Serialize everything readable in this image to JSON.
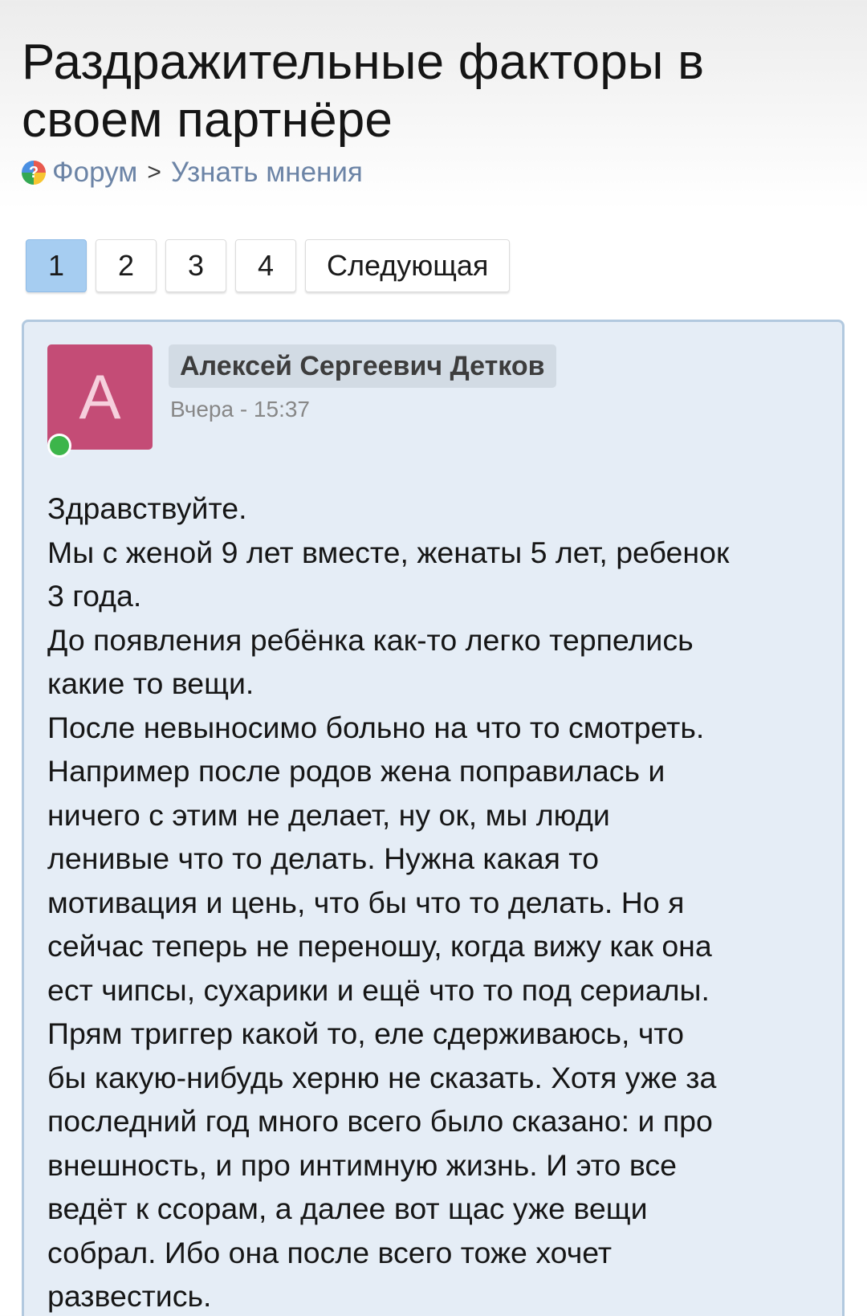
{
  "page": {
    "title_line1": "Раздражительные факторы в",
    "title_line2": "своем партнёре"
  },
  "breadcrumb": {
    "icon": "question-icon",
    "forum": "Форум",
    "separator": ">",
    "section": "Узнать мнения"
  },
  "pagination": {
    "pages": [
      "1",
      "2",
      "3",
      "4"
    ],
    "current": "1",
    "next_label": "Следующая"
  },
  "post": {
    "avatar_letter": "А",
    "avatar_color": "#c44c76",
    "online_color": "#3cb54a",
    "author": "Алексей Сергеевич Детков",
    "time": "Вчера - 15:37",
    "lines": [
      "Здравствуйте.",
      "Мы с женой 9 лет вместе, женаты 5 лет, ребенок",
      "3 года.",
      "До появления ребёнка как-то легко терпелись",
      "какие то вещи.",
      "После невыносимо больно на что то смотреть.",
      "Например после родов жена поправилась и",
      "ничего с этим не делает, ну ок, мы люди",
      "ленивые что то делать. Нужна какая то",
      "мотивация и цень, что бы что то делать. Но я",
      "сейчас теперь не переношу, когда вижу как она",
      "ест чипсы, сухарики и ещё что то под сериалы.",
      "Прям триггер какой то, еле сдерживаюсь, что",
      "бы какую-нибудь херню не сказать. Хотя уже за",
      "последний год много всего было сказано: и про",
      "внешность, и про интимную жизнь. И это все",
      "ведёт к ссорам, а далее вот щас уже вещи",
      "собрал. Ибо она после всего тоже хочет",
      "развестись."
    ]
  },
  "colors": {
    "accent_link": "#6c84a6",
    "active_page": "#a6cdf1",
    "post_background": "#e5edf6",
    "post_border": "#b2c9df"
  }
}
